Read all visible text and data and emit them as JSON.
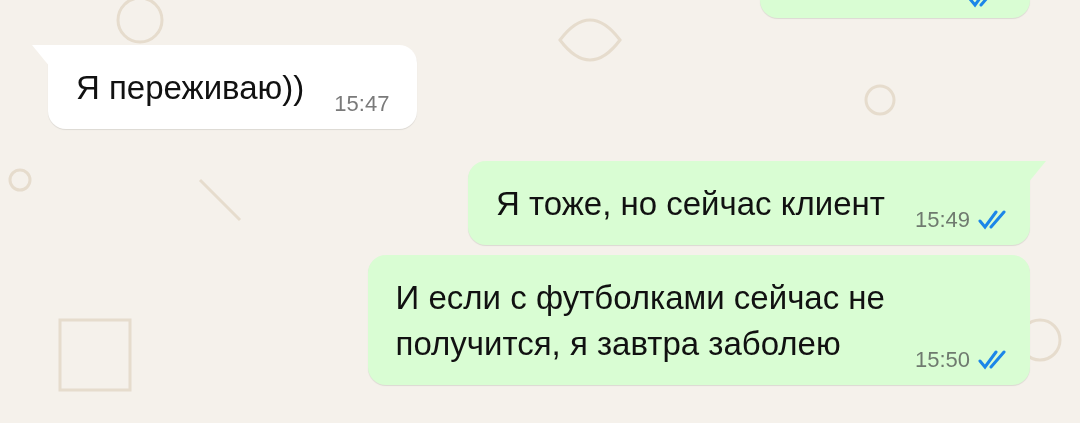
{
  "messages": [
    {
      "kind": "out",
      "tail": false,
      "read": true
    },
    {
      "kind": "in",
      "tail": true,
      "text": "Я переживаю))",
      "time": "15:47"
    },
    {
      "kind": "out",
      "tail": true,
      "read": true,
      "text": "Я тоже, но сейчас клиент",
      "time": "15:49"
    },
    {
      "kind": "out",
      "tail": false,
      "read": true,
      "text": "И если с футболками сейчас не\nполучится, я завтра заболею",
      "time": "15:50"
    }
  ]
}
